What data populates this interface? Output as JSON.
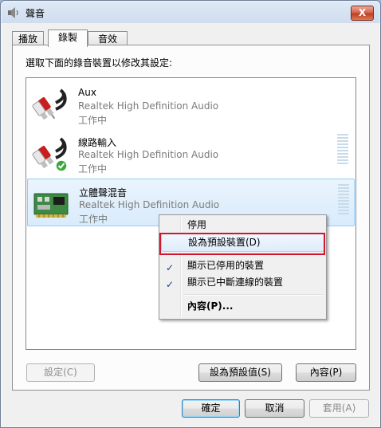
{
  "window": {
    "title": "聲音",
    "close_label": "X"
  },
  "tabs": [
    {
      "label": "播放",
      "active": false
    },
    {
      "label": "錄製",
      "active": true
    },
    {
      "label": "音效",
      "active": false
    }
  ],
  "instruction": "選取下面的錄音裝置以修改其設定:",
  "devices": [
    {
      "name": "Aux",
      "driver": "Realtek High Definition Audio",
      "status": "工作中",
      "icon": "rca-cable-icon",
      "default": false,
      "selected": false,
      "meter": false
    },
    {
      "name": "線路輸入",
      "driver": "Realtek High Definition Audio",
      "status": "工作中",
      "icon": "rca-cable-icon",
      "default": true,
      "selected": false,
      "meter": true
    },
    {
      "name": "立體聲混音",
      "driver": "Realtek High Definition Audio",
      "status": "工作中",
      "icon": "sound-card-icon",
      "default": false,
      "selected": true,
      "meter": true
    }
  ],
  "panel_buttons": {
    "configure": "設定(C)",
    "set_default": "設為預設值(S)",
    "properties": "內容(P)"
  },
  "dialog_buttons": {
    "ok": "確定",
    "cancel": "取消",
    "apply": "套用(A)"
  },
  "context_menu": {
    "items": [
      {
        "label": "停用",
        "checked": false,
        "bold": false
      },
      {
        "label": "設為預設裝置(D)",
        "checked": false,
        "bold": false,
        "highlight": true
      },
      {
        "label": "顯示已停用的裝置",
        "checked": true,
        "bold": false
      },
      {
        "label": "顯示已中斷連線的裝置",
        "checked": true,
        "bold": false
      },
      {
        "label": "內容(P)...",
        "checked": false,
        "bold": true
      }
    ]
  },
  "colors": {
    "accent": "#d3162d",
    "selection": "#d9ebfb",
    "default_badge": "#3aa83a"
  }
}
